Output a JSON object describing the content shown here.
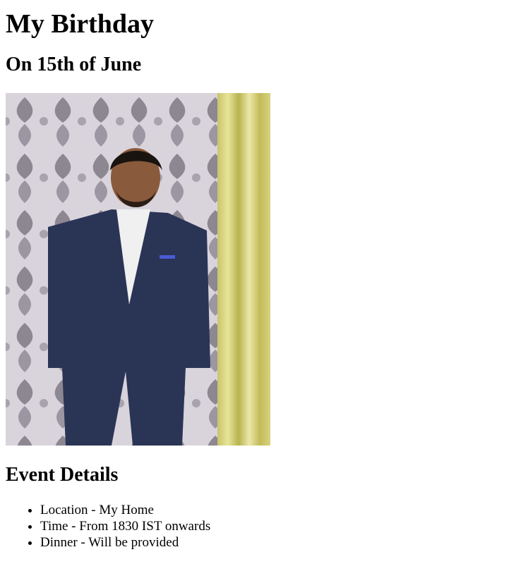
{
  "page": {
    "title": "My Birthday",
    "subtitle": "On 15th of June",
    "photo_name": "birthday-person-photo",
    "details_heading": "Event Details",
    "details": [
      "Location - My Home",
      "Time - From 1830 IST onwards",
      "Dinner - Will be provided"
    ]
  }
}
